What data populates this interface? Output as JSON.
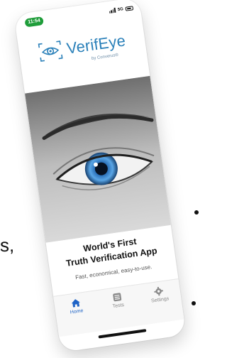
{
  "background": {
    "comma_text": "s,"
  },
  "status_bar": {
    "time": "11:54",
    "network": "5G",
    "time_pill_color": "#1f9d3a"
  },
  "brand": {
    "name": "VerifEye",
    "byline": "by Converus®",
    "accent_color": "#2a80b9",
    "icon": "eye-icon"
  },
  "hero": {
    "image": "close-up-blue-eye-icon"
  },
  "headline": {
    "line1": "World's First",
    "line2": "Truth Verification App"
  },
  "tagline": "Fast, economical, easy-to-use.",
  "tabbar": {
    "active_color": "#1e63c6",
    "items": [
      {
        "label": "Home",
        "icon": "home-icon",
        "active": true
      },
      {
        "label": "Tests",
        "icon": "list-icon",
        "active": false
      },
      {
        "label": "Settings",
        "icon": "gear-icon",
        "active": false
      }
    ]
  }
}
